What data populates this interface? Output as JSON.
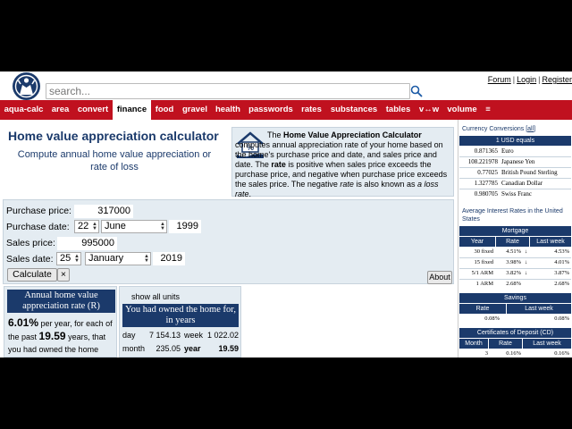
{
  "header": {
    "search_placeholder": "search...",
    "links": [
      "Forum",
      "Login",
      "Register"
    ]
  },
  "nav": {
    "items": [
      "aqua-calc",
      "area",
      "convert",
      "finance",
      "food",
      "gravel",
      "health",
      "passwords",
      "rates",
      "substances",
      "tables",
      "v↔w",
      "volume",
      "≡"
    ],
    "active": "finance"
  },
  "main": {
    "title": "Home value appreciation calculator",
    "subtitle": "Compute annual home value appreciation or rate of loss",
    "info": {
      "prefix": "The ",
      "name": "Home Value Appreciation Calculator",
      "text1": " computes annual appreciation rate of your home based on the home's purchase price and date, and sales price and date. The ",
      "rate_word": "rate",
      "text2": " is positive when sales price exceeds the purchase price, and negative when purchase price exceeds the sales price. The negative ",
      "rate_em": "rate",
      "text3": " is also known as ",
      "loss_em": "a loss rate",
      "text4": "."
    }
  },
  "form": {
    "purchase_price_label": "Purchase price:",
    "purchase_price": "317000",
    "purchase_date_label": "Purchase date:",
    "purchase_day": "22",
    "purchase_month": "June",
    "purchase_year": "1999",
    "sales_price_label": "Sales price:",
    "sales_price": "995000",
    "sales_date_label": "Sales date:",
    "sales_day": "25",
    "sales_month": "January",
    "sales_year": "2019",
    "calculate_label": "Calculate",
    "clear_label": "×",
    "about_label": "About"
  },
  "result1": {
    "heading": "Annual home value appreciation rate (R)",
    "rate": "6.01%",
    "text1": "per year, for each of the past",
    "years": "19.59",
    "text2": "years, that you had owned the home"
  },
  "result2": {
    "show_units": "show all units",
    "heading": "You had owned the home for, in years",
    "rows": [
      {
        "left_unit": "day",
        "left_value": "7 154.13",
        "right_unit": "week",
        "right_value": "1 022.02"
      },
      {
        "left_unit": "month",
        "left_value": "235.05",
        "right_unit": "year",
        "right_value": "19.59"
      }
    ]
  },
  "sidebar": {
    "currency": {
      "title": "Currency Conversions",
      "all_link": "all",
      "bar": "1 USD equals",
      "rows": [
        {
          "value": "0.871365",
          "name": "Euro"
        },
        {
          "value": "108.221978",
          "name": "Japanese Yen"
        },
        {
          "value": "0.77025",
          "name": "British Pound Sterling"
        },
        {
          "value": "1.327785",
          "name": "Canadian Dollar"
        },
        {
          "value": "0.980705",
          "name": "Swiss Franc"
        }
      ]
    },
    "interest": {
      "title": "Average Interest Rates in the United States",
      "mortgage_bar": "Mortgage",
      "mortgage_headers": [
        "Year",
        "Rate",
        "Last week"
      ],
      "mortgage_rows": [
        {
          "year": "30 fixed",
          "rate": "4.51%",
          "arrow": "↓",
          "last": "4.53%"
        },
        {
          "year": "15 fixed",
          "rate": "3.98%",
          "arrow": "↓",
          "last": "4.01%"
        },
        {
          "year": "5/1 ARM",
          "rate": "3.82%",
          "arrow": "↓",
          "last": "3.87%"
        },
        {
          "year": "1 ARM",
          "rate": "2.68%",
          "arrow": "",
          "last": "2.68%"
        }
      ],
      "savings_bar": "Savings",
      "savings_headers": [
        "Rate",
        "Last week"
      ],
      "savings_row": {
        "rate": "0.08%",
        "last": "0.08%"
      },
      "cd_bar": "Certificates of Deposit (CD)",
      "cd_headers": [
        "Month",
        "Rate",
        "Last week"
      ],
      "cd_rows": [
        {
          "month": "3",
          "rate": "0.16%",
          "last": "0.16%"
        }
      ]
    }
  },
  "colors": {
    "nav_red": "#c0111f",
    "navy": "#1b3a6b",
    "panel": "#e4ecf2"
  }
}
